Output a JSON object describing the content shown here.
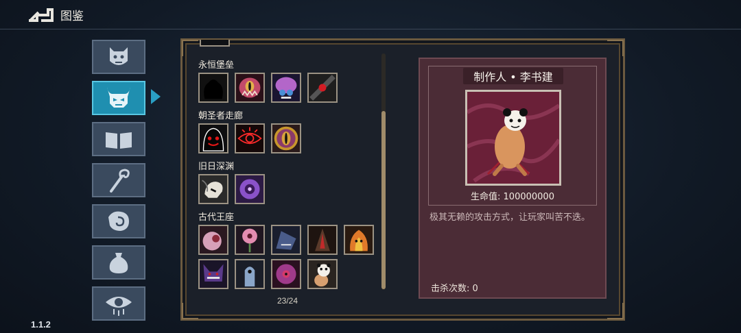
{
  "header": {
    "title": "图鉴",
    "version": "1.1.2"
  },
  "sidebar": {
    "tabs": [
      {
        "icon": "demon-face-icon",
        "active": false
      },
      {
        "icon": "horned-skull-icon",
        "active": true
      },
      {
        "icon": "open-book-icon",
        "active": false
      },
      {
        "icon": "staff-icon",
        "active": false
      },
      {
        "icon": "rune-hand-icon",
        "active": false
      },
      {
        "icon": "pouch-icon",
        "active": false
      },
      {
        "icon": "eye-icon",
        "active": false
      }
    ]
  },
  "bestiary": {
    "categories": [
      {
        "name": "永恒堡垒",
        "count": 4
      },
      {
        "name": "朝圣者走廊",
        "count": 3
      },
      {
        "name": "旧日深渊",
        "count": 2
      },
      {
        "name": "古代王座",
        "count": 9
      }
    ],
    "page_count": "23/24"
  },
  "detail": {
    "name": "制作人 • 李书建",
    "hp_label": "生命值:",
    "hp_value": "100000000",
    "description": "极其无赖的攻击方式，让玩家叫苦不迭。",
    "kills_label": "击杀次数:",
    "kills_value": "0"
  },
  "colors": {
    "accent": "#1f8fb0",
    "panel": "#4b2c36",
    "frame": "#6c5a3f"
  }
}
